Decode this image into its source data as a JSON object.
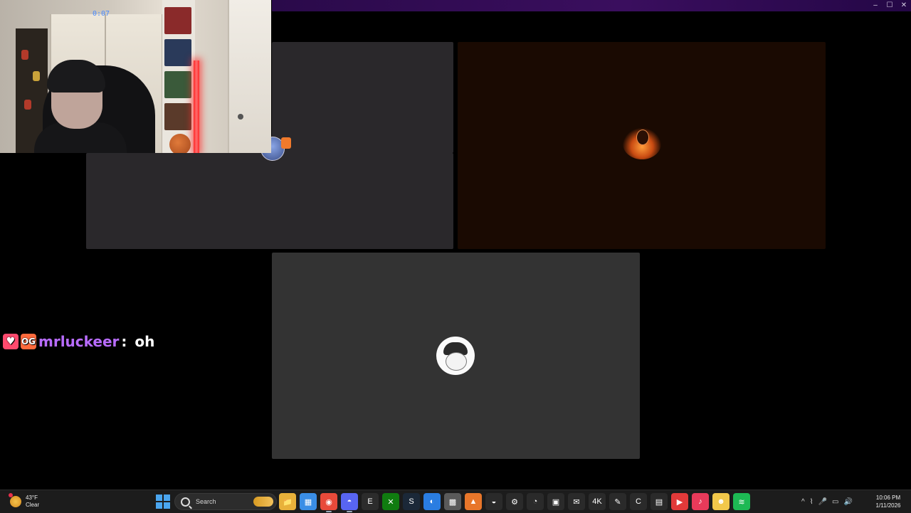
{
  "window": {
    "controls": {
      "minimize": "–",
      "maximize": "☐",
      "close": "✕"
    }
  },
  "webcam": {
    "ceiling_text": "0:07"
  },
  "chat": {
    "og_badge": "OG",
    "username": "mrluckeer",
    "colon": ":",
    "message": "oh",
    "user_color": "#b86cff"
  },
  "taskbar": {
    "weather": {
      "temp": "43°F",
      "condition": "Clear"
    },
    "search_label": "Search",
    "apps": [
      {
        "name": "file-explorer-icon",
        "glyph": "📁",
        "color": "#e8b13a"
      },
      {
        "name": "store-icon",
        "glyph": "▦",
        "color": "#3a8ee6"
      },
      {
        "name": "chrome-icon",
        "glyph": "◉",
        "color": "#e84a3a",
        "active": true
      },
      {
        "name": "discord-icon",
        "glyph": "◓",
        "color": "#5865f2",
        "active": true
      },
      {
        "name": "epic-games-icon",
        "glyph": "E",
        "color": "#2c2c2c"
      },
      {
        "name": "xbox-icon",
        "glyph": "✕",
        "color": "#107c10"
      },
      {
        "name": "steam-icon",
        "glyph": "S",
        "color": "#1b2838"
      },
      {
        "name": "browser-icon",
        "glyph": "◐",
        "color": "#2a7de1"
      },
      {
        "name": "minecraft-icon",
        "glyph": "▩",
        "color": "#5a5a5a"
      },
      {
        "name": "vlc-icon",
        "glyph": "▲",
        "color": "#e8762a"
      },
      {
        "name": "obs-icon",
        "glyph": "◒",
        "color": "#2a2a2a"
      },
      {
        "name": "settings-icon",
        "glyph": "⚙",
        "color": "#2a2a2a"
      },
      {
        "name": "timer-icon",
        "glyph": "◔",
        "color": "#2a2a2a"
      },
      {
        "name": "terminal-icon",
        "glyph": "▣",
        "color": "#2a2a2a"
      },
      {
        "name": "mail-icon",
        "glyph": "✉",
        "color": "#2a2a2a"
      },
      {
        "name": "4k-icon",
        "glyph": "4K",
        "color": "#2a2a2a"
      },
      {
        "name": "tool-icon",
        "glyph": "✎",
        "color": "#2a2a2a"
      },
      {
        "name": "edge-icon",
        "glyph": "C",
        "color": "#2a2a2a"
      },
      {
        "name": "bag-icon",
        "glyph": "▤",
        "color": "#2a2a2a"
      },
      {
        "name": "youtube-icon",
        "glyph": "▶",
        "color": "#e23a3a"
      },
      {
        "name": "music-icon",
        "glyph": "♪",
        "color": "#e83a5a"
      },
      {
        "name": "emoji-icon",
        "glyph": "☻",
        "color": "#f2c84a"
      },
      {
        "name": "spotify-icon",
        "glyph": "≋",
        "color": "#1db954"
      }
    ],
    "tray": {
      "chevron": "^",
      "network": "⌇",
      "mic": "🎤",
      "display": "▭",
      "volume": "🔊"
    },
    "clock": {
      "time": "10:06 PM",
      "date": "1/11/2026"
    }
  }
}
